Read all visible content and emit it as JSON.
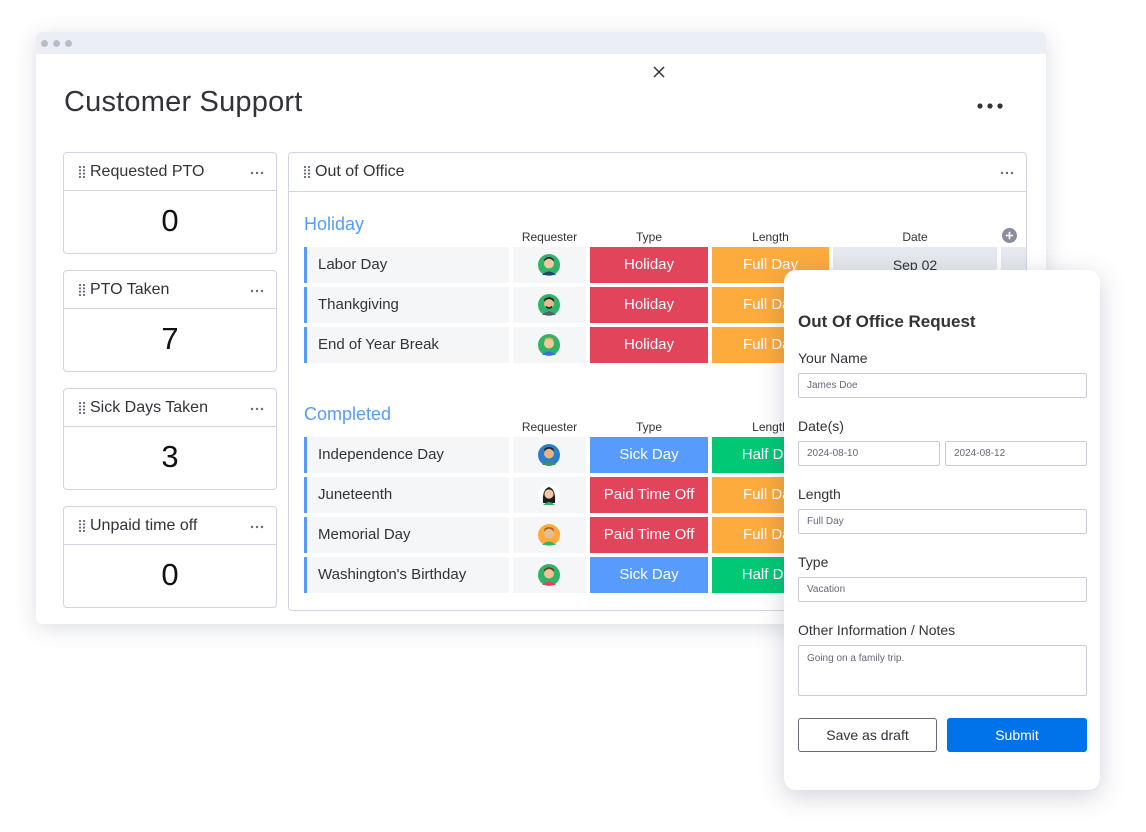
{
  "board": {
    "title": "Customer Support"
  },
  "widgets": [
    {
      "title": "Requested PTO",
      "value": "0"
    },
    {
      "title": "PTO Taken",
      "value": "7"
    },
    {
      "title": "Sick Days Taken",
      "value": "3"
    },
    {
      "title": "Unpaid time off",
      "value": "0"
    }
  ],
  "table": {
    "title": "Out of Office",
    "columns": {
      "requester": "Requester",
      "type": "Type",
      "length": "Length",
      "date": "Date"
    },
    "groups": [
      {
        "title": "Holiday",
        "rows": [
          {
            "name": "Labor Day",
            "type": "Holiday",
            "length": "Full Day",
            "date": "Sep 02"
          },
          {
            "name": "Thankgiving",
            "type": "Holiday",
            "length": "Full Day"
          },
          {
            "name": "End of Year Break",
            "type": "Holiday",
            "length": "Full Day"
          }
        ]
      },
      {
        "title": "Completed",
        "rows": [
          {
            "name": "Independence Day",
            "type": "Sick Day",
            "length": "Half Day"
          },
          {
            "name": "Juneteenth",
            "type": "Paid Time Off",
            "length": "Full Day"
          },
          {
            "name": "Memorial Day",
            "type": "Paid Time Off",
            "length": "Full Day"
          },
          {
            "name": "Washington's Birthday",
            "type": "Sick Day",
            "length": "Half Day"
          }
        ]
      }
    ]
  },
  "form": {
    "title": "Out Of Office Request",
    "name_label": "Your Name",
    "name_value": "James Doe",
    "dates_label": "Date(s)",
    "date_start": "2024-08-10",
    "date_end": "2024-08-12",
    "length_label": "Length",
    "length_value": "Full Day",
    "type_label": "Type",
    "type_value": "Vacation",
    "notes_label": "Other Information / Notes",
    "notes_value": "Going on a family trip.",
    "draft_button": "Save as draft",
    "submit_button": "Submit"
  },
  "icons": {
    "close": "close-icon",
    "more": "more-options-icon",
    "drag": "drag-handle-icon",
    "add_column": "plus-circle-icon",
    "avatar": "person-avatar-icon"
  },
  "colors": {
    "holiday": "#e2445c",
    "full_day": "#fdab3d",
    "half_day": "#00c875",
    "sick_day": "#579bfc",
    "paid_time_off": "#e2445c",
    "group_blue": "#579bfc",
    "submit_blue": "#0073ea"
  }
}
